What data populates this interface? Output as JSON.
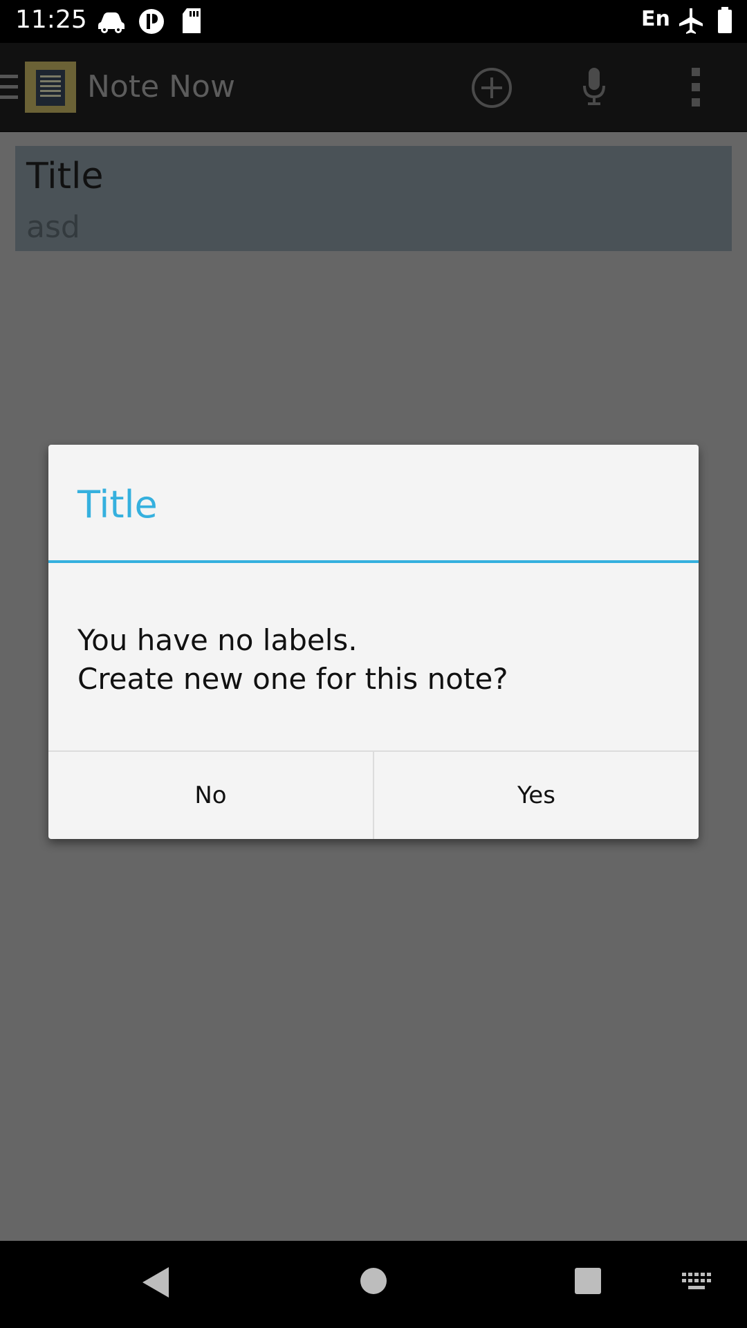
{
  "status_bar": {
    "time": "11:25",
    "language": "En",
    "icons": [
      "car-icon",
      "bluetooth-alt-icon",
      "sd-card-icon",
      "airplane-icon",
      "battery-icon"
    ]
  },
  "app_bar": {
    "title": "Note Now",
    "icons": [
      "menu-icon",
      "app-notebook-icon",
      "add-note-icon",
      "microphone-icon",
      "overflow-menu-icon"
    ]
  },
  "note": {
    "title": "Title",
    "body": "asd"
  },
  "dialog": {
    "title": "Title",
    "message_line1": "You have no labels.",
    "message_line2": "Create new one for this note?",
    "no_label": "No",
    "yes_label": "Yes",
    "accent_color": "#35b0de"
  },
  "nav_bar": {
    "icons": [
      "back-icon",
      "home-icon",
      "recents-icon",
      "keyboard-icon"
    ]
  }
}
